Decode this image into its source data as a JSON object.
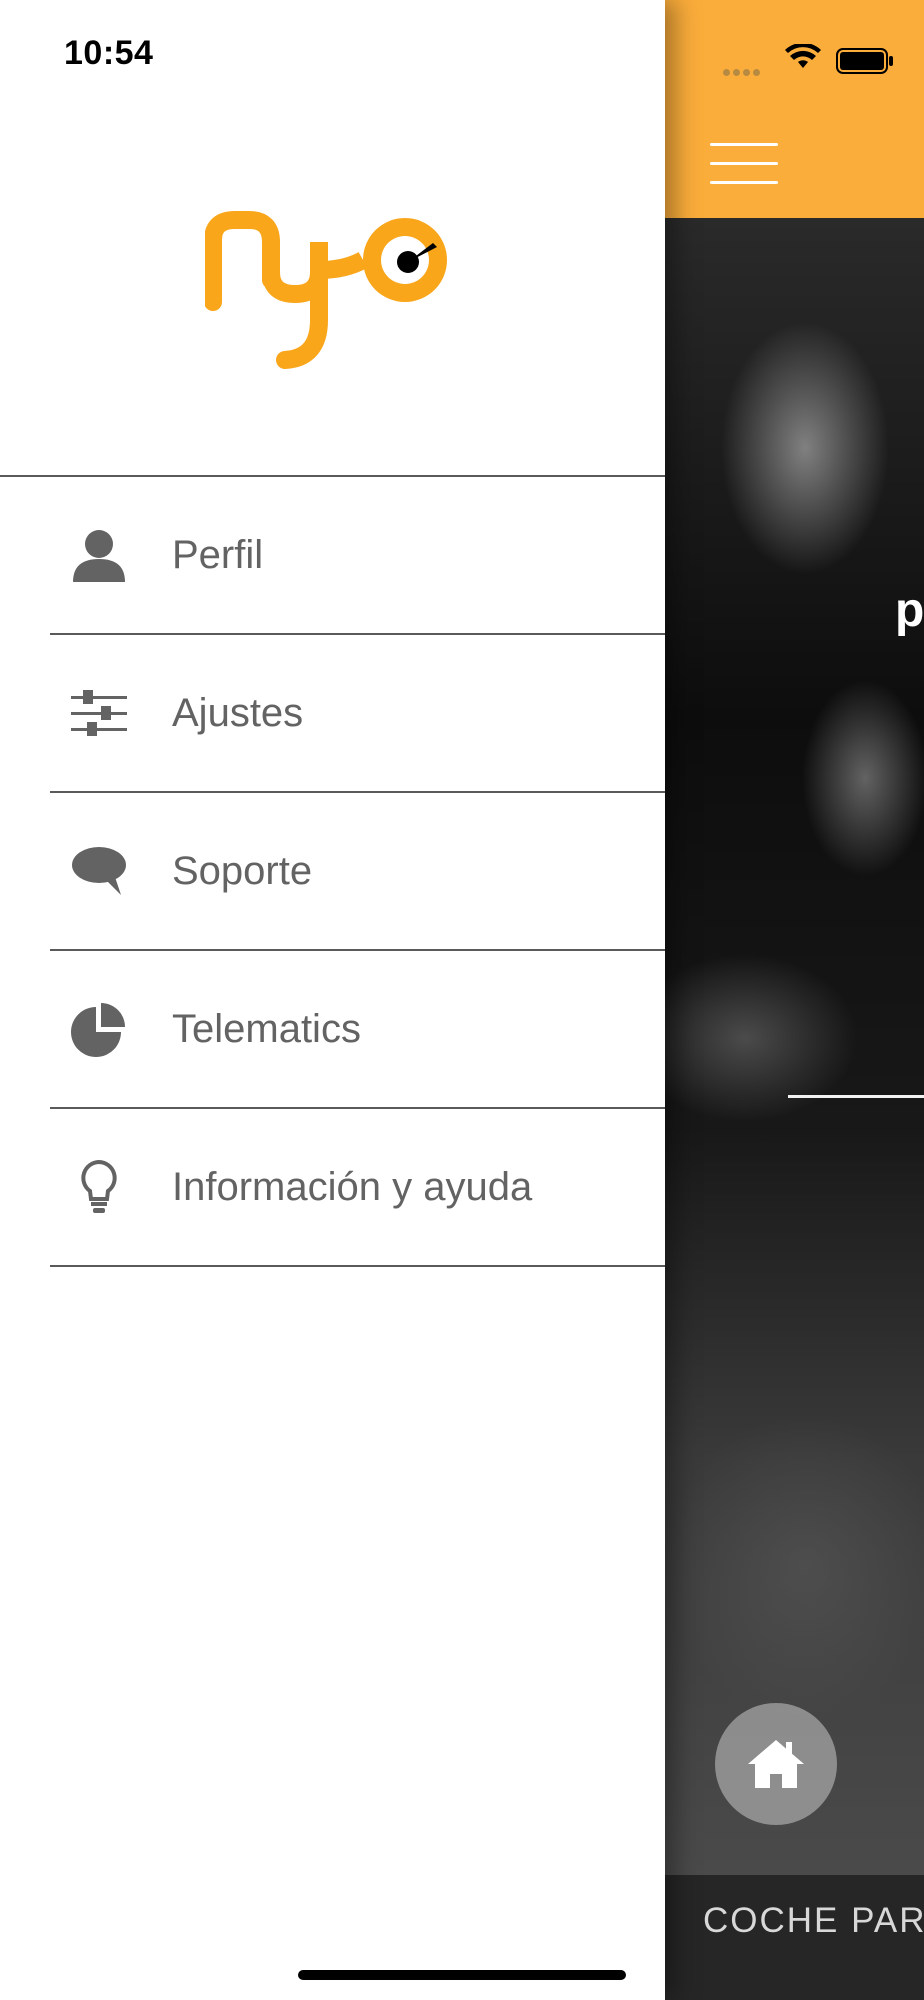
{
  "status_bar": {
    "time": "10:54"
  },
  "logo": {
    "text": "nyo",
    "color": "#f9a61b"
  },
  "menu": {
    "items": [
      {
        "label": "Perfil",
        "icon": "person-icon"
      },
      {
        "label": "Ajustes",
        "icon": "sliders-icon"
      },
      {
        "label": "Soporte",
        "icon": "speech-bubble-icon"
      },
      {
        "label": "Telematics",
        "icon": "pie-chart-icon"
      },
      {
        "label": "Información y ayuda",
        "icon": "lightbulb-icon"
      }
    ]
  },
  "background_app": {
    "header_color": "#fbad3b",
    "partial_text": "p",
    "bottom_label": "COCHE PAR"
  },
  "colors": {
    "accent": "#fbad3b",
    "menu_text": "#636363",
    "divider": "#5a5a5a"
  }
}
